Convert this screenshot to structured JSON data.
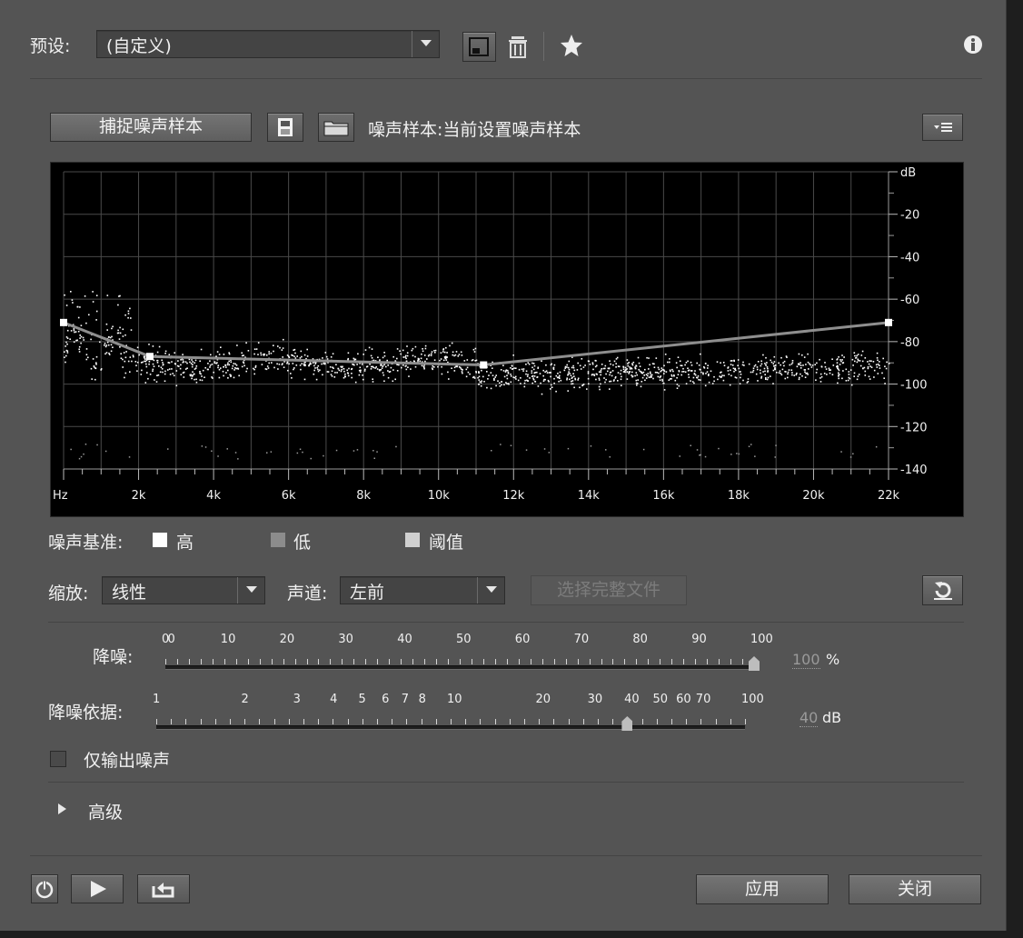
{
  "header": {
    "preset_label": "预设:",
    "preset_value": "(自定义)",
    "icons": [
      "save-preset-icon",
      "trash-icon",
      "favorite-star-icon",
      "info-icon"
    ]
  },
  "noise_print": {
    "capture_button": "捕捉噪声样本",
    "sample_label": "噪声样本:当前设置噪声样本"
  },
  "graph": {
    "db_ticks": [
      "dB",
      "-20",
      "-40",
      "-60",
      "-80",
      "-100",
      "-120",
      "-140"
    ],
    "hz_ticks": [
      "Hz",
      "2k",
      "4k",
      "6k",
      "8k",
      "10k",
      "12k",
      "14k",
      "16k",
      "18k",
      "20k",
      "22k"
    ]
  },
  "chart_data": {
    "type": "line",
    "xlabel": "Hz",
    "ylabel": "dB",
    "xlim": [
      0,
      22000
    ],
    "ylim": [
      -140,
      0
    ],
    "series": [
      {
        "name": "阈值",
        "x": [
          0,
          2300,
          11200,
          22000
        ],
        "y": [
          -71,
          -87,
          -91,
          -71
        ]
      }
    ],
    "legend": {
      "title": "噪声基准:",
      "items": [
        "高",
        "低",
        "阈值"
      ],
      "colors": [
        "#ffffff",
        "#8c8c8c",
        "#d0d0d0"
      ]
    }
  },
  "controls": {
    "scale_label": "缩放:",
    "scale_value": "线性",
    "channel_label": "声道:",
    "channel_value": "左前",
    "select_file_button": "选择完整文件"
  },
  "sliders": {
    "reduction": {
      "label": "降噪:",
      "tick_labels": [
        "0",
        "0",
        "10",
        "20",
        "30",
        "40",
        "50",
        "60",
        "70",
        "80",
        "90",
        "100"
      ],
      "value": "100",
      "unit": "%",
      "fraction": 1.0
    },
    "reduce_by": {
      "label": "降噪依据:",
      "tick_labels": [
        "1",
        "2",
        "3",
        "4",
        "5",
        "6",
        "7",
        "8",
        "10",
        "20",
        "30",
        "40",
        "50",
        "60",
        "70",
        "100"
      ],
      "value": "40",
      "unit": "dB",
      "fraction": 0.8
    }
  },
  "options": {
    "output_noise_only": "仅输出噪声",
    "output_noise_only_checked": false,
    "advanced": "高级"
  },
  "footer": {
    "apply_button": "应用",
    "close_button": "关闭"
  }
}
